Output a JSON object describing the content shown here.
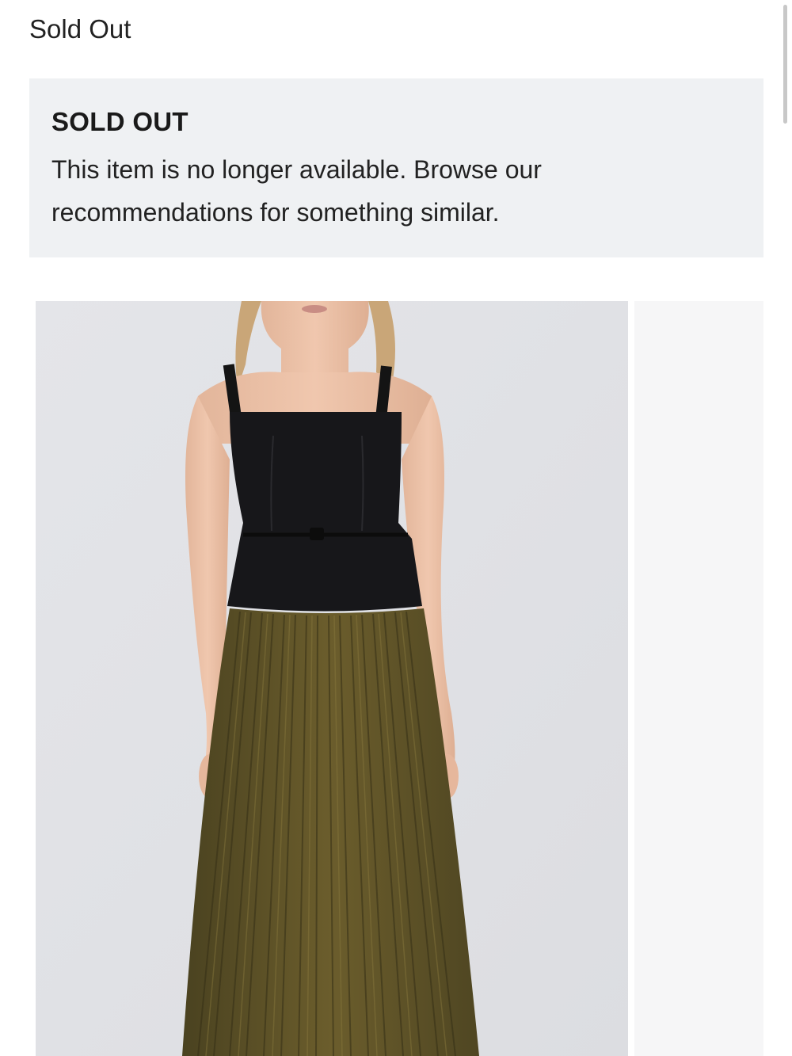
{
  "header": {
    "status_text": "Sold Out"
  },
  "sold_out_notice": {
    "title": "SOLD OUT",
    "message": "This item is no longer available. Browse our recommendations for something similar."
  },
  "gallery": {
    "main_image": "product-photo-black-peplum-top-olive-pleated-skirt",
    "next_image": "product-photo-next-placeholder"
  }
}
